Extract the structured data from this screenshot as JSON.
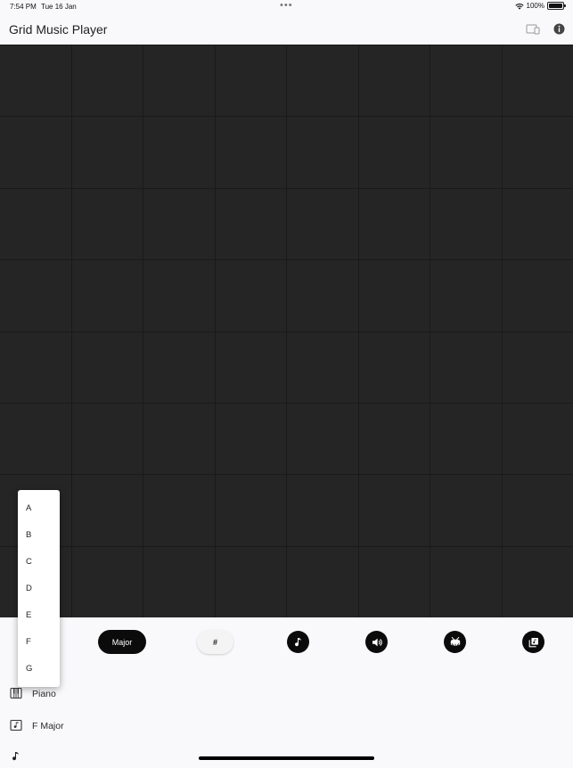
{
  "status": {
    "time": "7:54 PM",
    "date": "Tue 16 Jan",
    "dots": "•••",
    "battery": "100%"
  },
  "app": {
    "title": "Grid Music Player"
  },
  "toolbar": {
    "scale_label": "Major",
    "sharp_label": "#"
  },
  "dropdown": {
    "items": [
      "A",
      "B",
      "C",
      "D",
      "E",
      "F",
      "G"
    ]
  },
  "list": [
    {
      "label": "Piano",
      "icon": "piano-icon"
    },
    {
      "label": "F Major",
      "icon": "music-note-box-icon"
    },
    {
      "label": "",
      "icon": "music-note-icon"
    }
  ],
  "colors": {
    "grid_cell": "#252525",
    "grid_line": "#1a1a1a",
    "background": "#f9f8fb",
    "button_dark": "#0b0b0b"
  }
}
